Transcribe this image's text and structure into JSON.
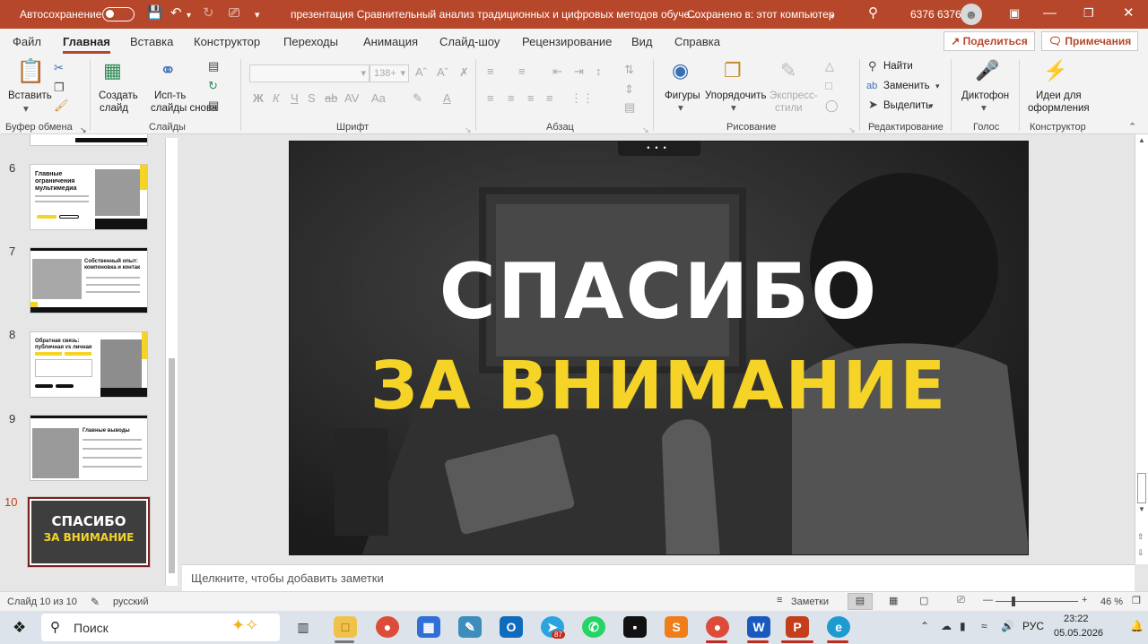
{
  "titlebar": {
    "autosave_label": "Автосохранение",
    "doc_title": "презентация Сравнительный анализ традиционных и цифровых методов обуче...",
    "save_state": "Сохранено в: этот компьютер",
    "user_name": "6376 6376"
  },
  "menu": {
    "tabs": [
      "Файл",
      "Главная",
      "Вставка",
      "Конструктор",
      "Переходы",
      "Анимация",
      "Слайд-шоу",
      "Рецензирование",
      "Вид",
      "Справка"
    ],
    "active_tab": "Главная",
    "share": "Поделиться",
    "comments": "Примечания"
  },
  "ribbon": {
    "groups": {
      "clipboard": "Буфер обмена",
      "slides": "Слайды",
      "font": "Шрифт",
      "paragraph": "Абзац",
      "drawing": "Рисование",
      "editing": "Редактирование",
      "voice": "Голос",
      "designer": "Конструктор"
    },
    "paste": "Вставить",
    "new_slide_1": "Создать",
    "new_slide_2": "слайд",
    "reuse_1": "Исп-ть",
    "reuse_2": "слайды снова",
    "font_size": "138+",
    "shapes": "Фигуры",
    "arrange": "Упорядочить",
    "quick_styles_1": "Экспресс-",
    "quick_styles_2": "стили",
    "find": "Найти",
    "replace": "Заменить",
    "select": "Выделить",
    "dictate": "Диктофон",
    "design_ideas_1": "Идеи для",
    "design_ideas_2": "оформления"
  },
  "thumbnails": [
    {
      "num": "6",
      "title": "Главные ограничения мультимедиа"
    },
    {
      "num": "7",
      "title": "Собственный опыт: компоновка и контак"
    },
    {
      "num": "8",
      "title": "Обратная связь: публичная vs личная"
    },
    {
      "num": "9",
      "title": "Главные выводы"
    },
    {
      "num": "10",
      "line1": "СПАСИБО",
      "line2": "ЗА ВНИМАНИЕ"
    }
  ],
  "slide": {
    "line1": "СПАСИБО",
    "line2": "ЗА ВНИМАНИЕ",
    "accent_color": "#f5d327"
  },
  "notes_placeholder": "Щелкните, чтобы добавить заметки",
  "status": {
    "slide_counter": "Слайд 10 из 10",
    "language": "русский",
    "notes_btn": "Заметки",
    "zoom": "46 %",
    "zoom_fraction": 0.46
  },
  "taskbar": {
    "search": "Поиск",
    "lang": "РУС",
    "time": "23:22",
    "date": "05.05.2026",
    "telegram_badge": "87"
  },
  "colors": {
    "ppt_red": "#b7472a",
    "slide_yellow": "#f5d327"
  }
}
